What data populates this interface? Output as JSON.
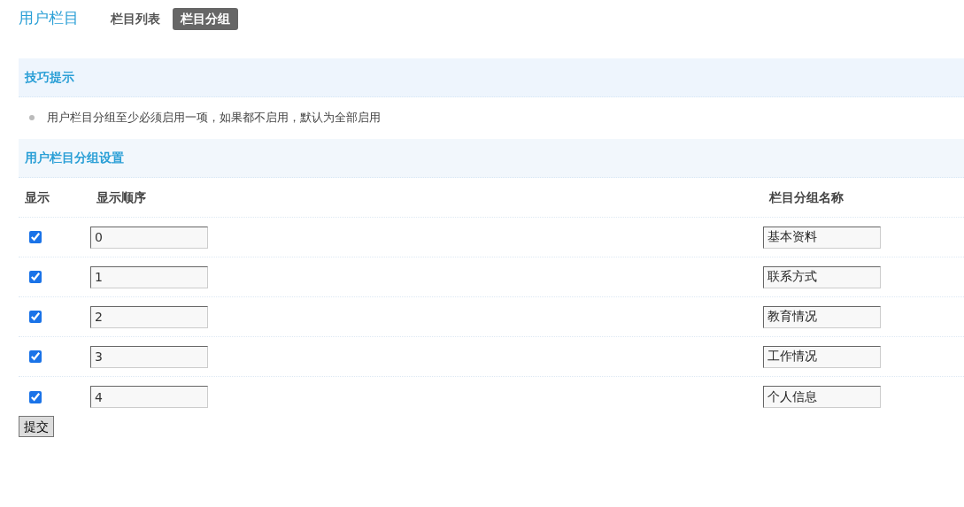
{
  "header": {
    "title": "用户栏目",
    "tabs": [
      {
        "label": "栏目列表",
        "selected": false
      },
      {
        "label": "栏目分组",
        "selected": true
      }
    ]
  },
  "tips": {
    "title": "技巧提示",
    "items": [
      "用户栏目分组至少必须启用一项，如果都不启用，默认为全部启用"
    ]
  },
  "settings": {
    "title": "用户栏目分组设置",
    "columns": [
      "显示",
      "显示顺序",
      "栏目分组名称"
    ],
    "rows": [
      {
        "checked": true,
        "order": "0",
        "name": "基本资料"
      },
      {
        "checked": true,
        "order": "1",
        "name": "联系方式"
      },
      {
        "checked": true,
        "order": "2",
        "name": "教育情况"
      },
      {
        "checked": true,
        "order": "3",
        "name": "工作情况"
      },
      {
        "checked": true,
        "order": "4",
        "name": "个人信息"
      }
    ]
  },
  "submit": "提交"
}
